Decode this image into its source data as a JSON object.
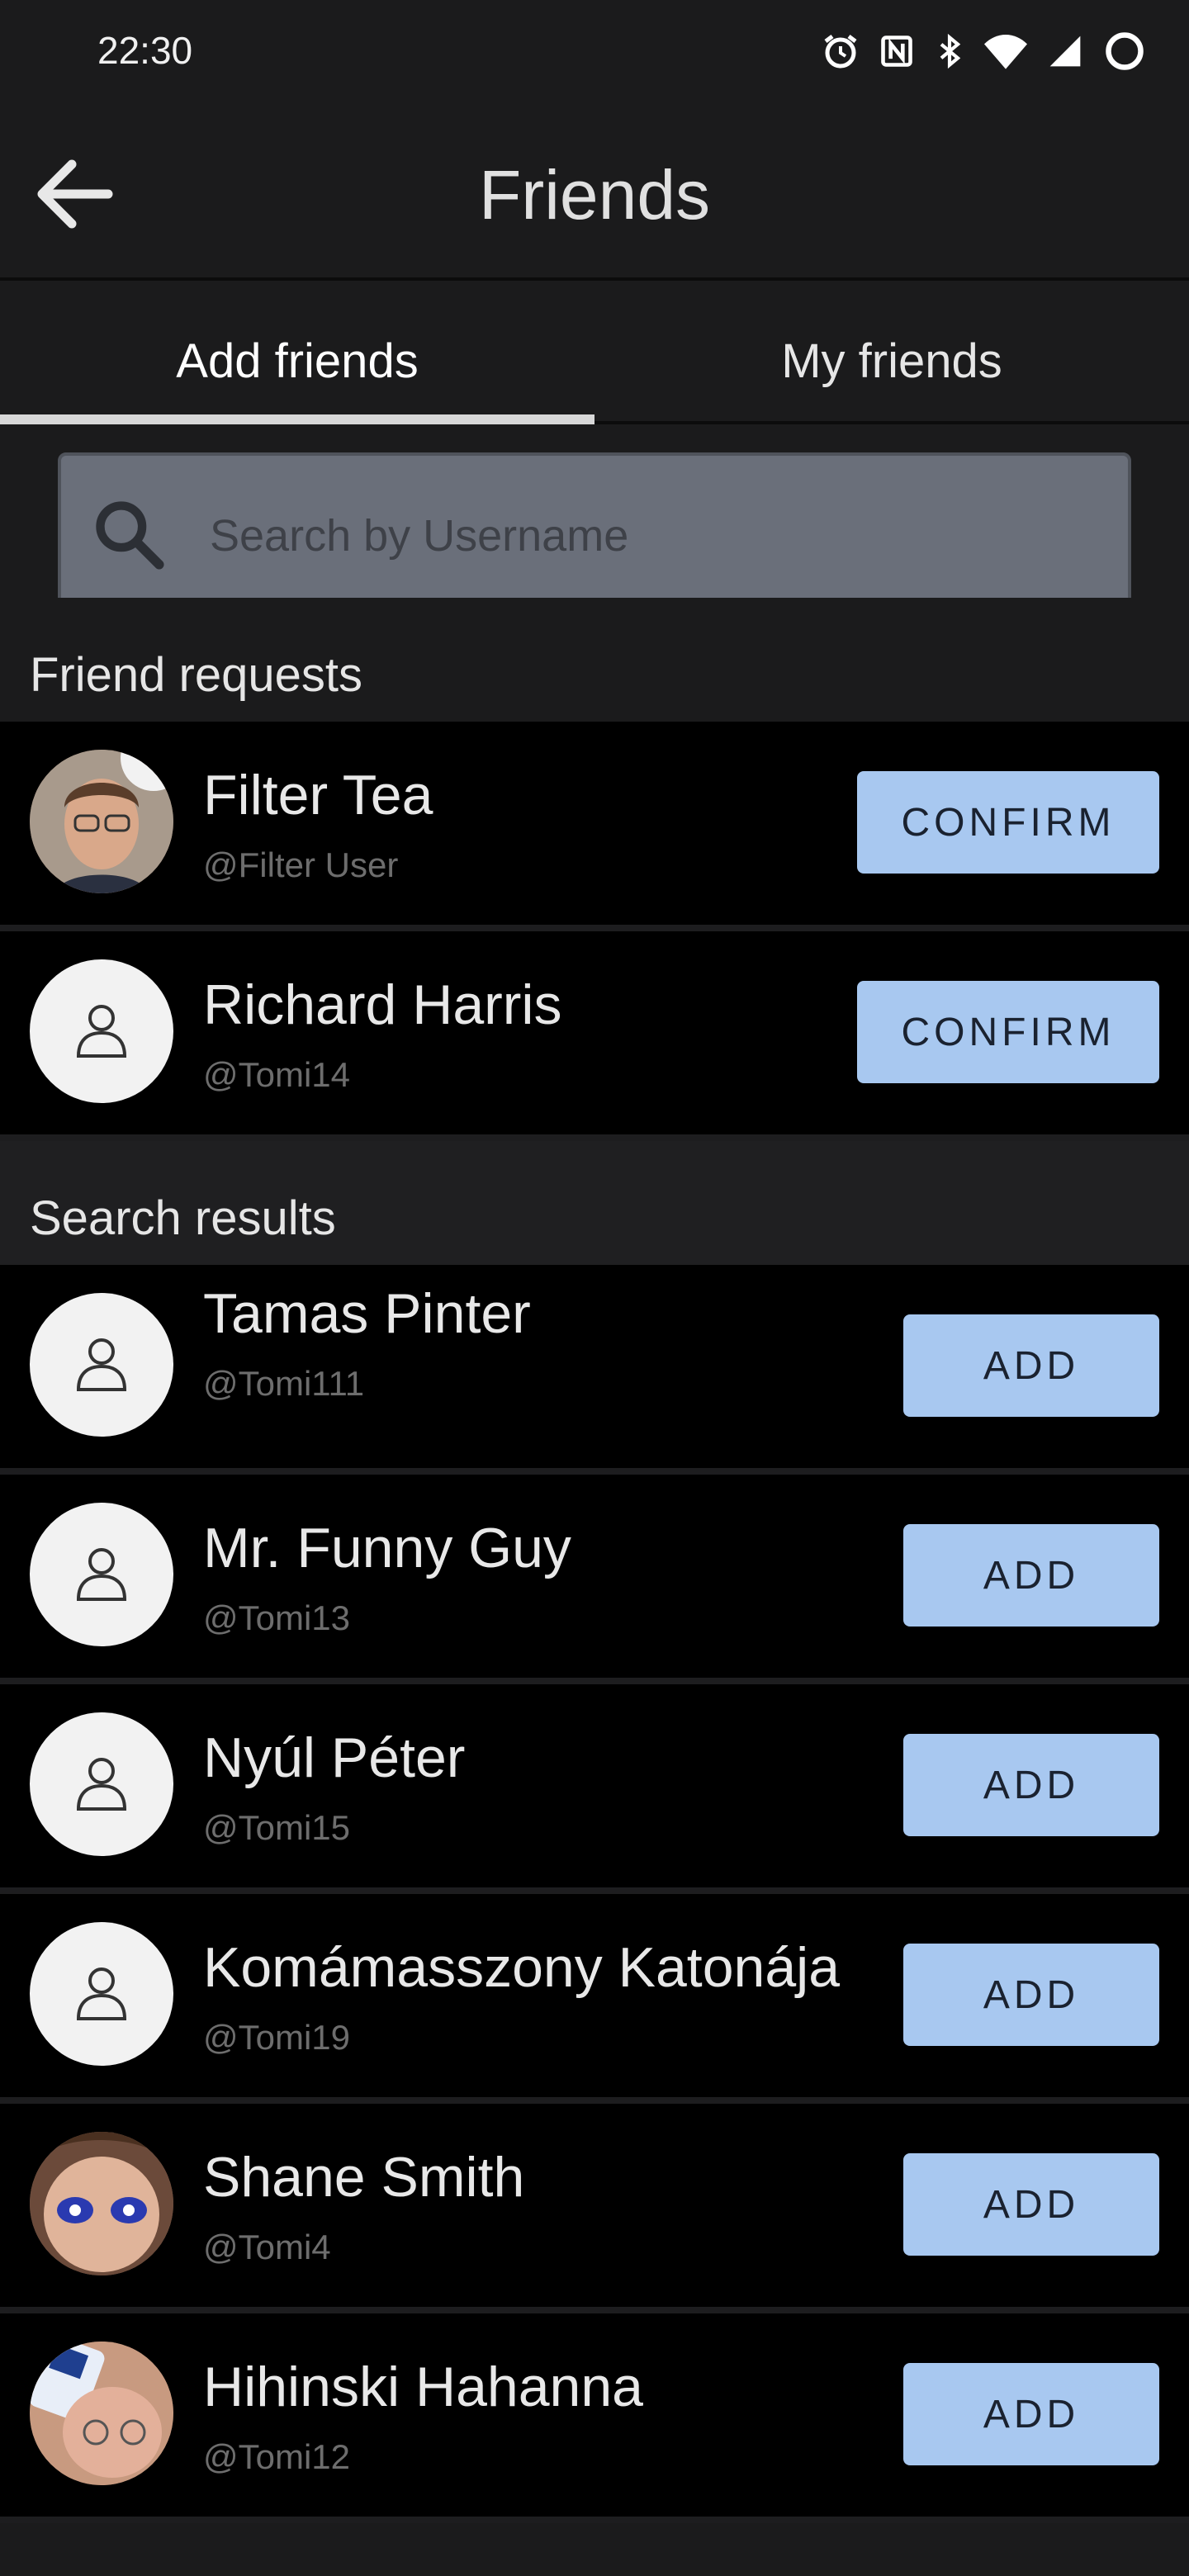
{
  "status": {
    "time": "22:30",
    "icons": [
      "alarm-icon",
      "nfc-icon",
      "bluetooth-icon",
      "wifi-icon",
      "signal-icon",
      "battery-icon"
    ]
  },
  "header": {
    "title": "Friends",
    "back_icon": "arrow-back-icon"
  },
  "tabs": [
    {
      "label": "Add friends",
      "active": true
    },
    {
      "label": "My friends",
      "active": false
    }
  ],
  "search": {
    "placeholder": "Search by Username",
    "value": ""
  },
  "friend_requests": {
    "title": "Friend requests",
    "items": [
      {
        "name": "Filter Tea",
        "handle": "@Filter User",
        "avatar": "photo",
        "action": "CONFIRM"
      },
      {
        "name": "Richard Harris",
        "handle": "@Tomi14",
        "avatar": "default",
        "action": "CONFIRM"
      }
    ]
  },
  "search_results": {
    "title": "Search results",
    "items": [
      {
        "name": "Tamas Pinter",
        "handle": "@Tomi111",
        "avatar": "default",
        "action": "ADD"
      },
      {
        "name": "Mr. Funny Guy",
        "handle": "@Tomi13",
        "avatar": "default",
        "action": "ADD"
      },
      {
        "name": "Nyúl Péter",
        "handle": "@Tomi15",
        "avatar": "default",
        "action": "ADD"
      },
      {
        "name": "Komámasszony Katonája",
        "handle": "@Tomi19",
        "avatar": "default",
        "action": "ADD"
      },
      {
        "name": "Shane Smith",
        "handle": "@Tomi4",
        "avatar": "photo",
        "action": "ADD"
      },
      {
        "name": "Hihinski Hahanna",
        "handle": "@Tomi12",
        "avatar": "photo",
        "action": "ADD"
      }
    ]
  },
  "colors": {
    "background": "#1b1b1c",
    "list_background": "#000000",
    "button": "#a8c8f0",
    "search_box": "#6a6f7a"
  }
}
